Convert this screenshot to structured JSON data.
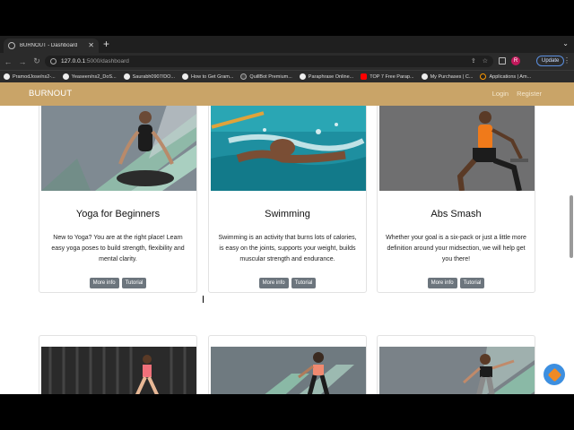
{
  "browser": {
    "tab_title": "BURNOUT - Dashboard",
    "url_host": "127.0.0.1",
    "url_path": ":5000/dashboard",
    "update_label": "Update",
    "profile_initial": "R",
    "bookmarks": [
      {
        "label": "PramodJose/ns2-...",
        "icon": "github-icon"
      },
      {
        "label": "Yeaseen/ns2_DoS...",
        "icon": "github-icon"
      },
      {
        "label": "Saurabh0907/DO...",
        "icon": "github-icon"
      },
      {
        "label": "How to Get Gram...",
        "icon": "globe-icon"
      },
      {
        "label": "QuillBot Premium...",
        "icon": "doc-icon"
      },
      {
        "label": "Paraphrase Online...",
        "icon": "globe-icon"
      },
      {
        "label": "TOP 7 Free Parap...",
        "icon": "youtube-icon"
      },
      {
        "label": "My Purchases | C...",
        "icon": "globe-icon"
      },
      {
        "label": "Applications | Am...",
        "icon": "amazon-icon"
      }
    ]
  },
  "navbar": {
    "brand": "BURNOUT",
    "login": "Login",
    "register": "Register",
    "bg_color": "#c9a468"
  },
  "cards": [
    {
      "title": "Yoga for Beginners",
      "description": "New to Yoga? You are at the right place! Learn easy yoga poses to build strength, flexibility and mental clarity.",
      "more_info": "More info",
      "tutorial": "Tutorial"
    },
    {
      "title": "Swimming",
      "description": "Swimming is an activity that burns lots of calories, is easy on the joints, supports your weight, builds muscular strength and endurance.",
      "more_info": "More info",
      "tutorial": "Tutorial"
    },
    {
      "title": "Abs Smash",
      "description": "Whether your goal is a six-pack or just a little more definition around your midsection, we will help get you there!",
      "more_info": "More info",
      "tutorial": "Tutorial"
    }
  ]
}
